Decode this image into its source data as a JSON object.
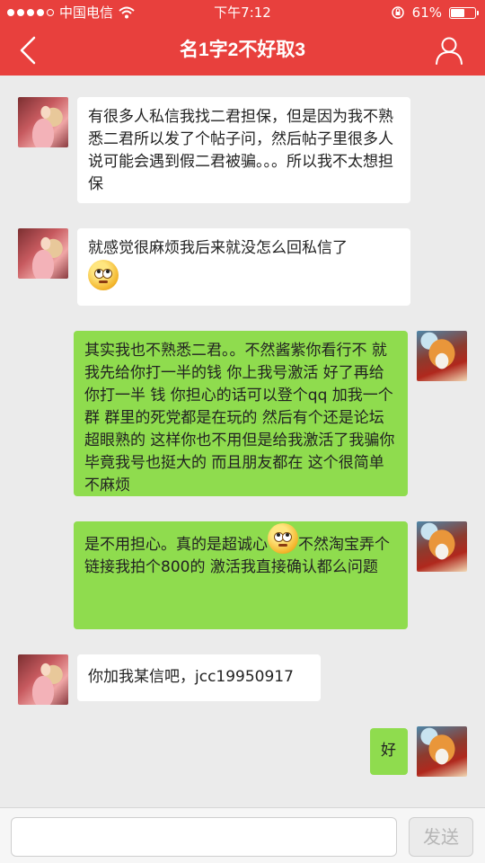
{
  "status_bar": {
    "carrier": "中国电信",
    "time": "下午7:12",
    "battery_percent": "61%",
    "battery_level": 0.61
  },
  "header": {
    "title": "名1字2不好取3",
    "back_icon": "chevron-left-icon",
    "user_icon": "user-icon"
  },
  "colors": {
    "header_bg": "#e8403d",
    "bubble_incoming": "#ffffff",
    "bubble_outgoing": "#8fdc4e"
  },
  "messages": [
    {
      "side": "left",
      "text": "有很多人私信我找二君担保，但是因为我不熟悉二君所以发了个帖子问，然后帖子里很多人说可能会遇到假二君被骗。。。所以我不太想担保"
    },
    {
      "side": "left",
      "text": "就感觉很麻烦我后来就没怎么回私信了",
      "emoji": "rolling-eyes-emoji"
    },
    {
      "side": "right",
      "text": "其实我也不熟悉二君。。不然酱紫你看行不 就我先给你打一半的钱 你上我号激活 好了再给你打一半 钱 你担心的话可以登个qq 加我一个群 群里的死党都是在玩的 然后有个还是论坛超眼熟的 这样你也不用但是给我激活了我骗你 毕竟我号也挺大的 而且朋友都在 这个很简单不麻烦"
    },
    {
      "side": "right",
      "text_before": "是不用担心。真的是超诚心",
      "text_after": "不然淘宝弄个链接我拍个800的 激活我直接确认都么问题",
      "emoji": "rolling-eyes-emoji"
    },
    {
      "side": "left",
      "text": "你加我某信吧，jcc19950917"
    },
    {
      "side": "right",
      "text": "好"
    }
  ],
  "input_bar": {
    "value": "",
    "send_label": "发送"
  }
}
